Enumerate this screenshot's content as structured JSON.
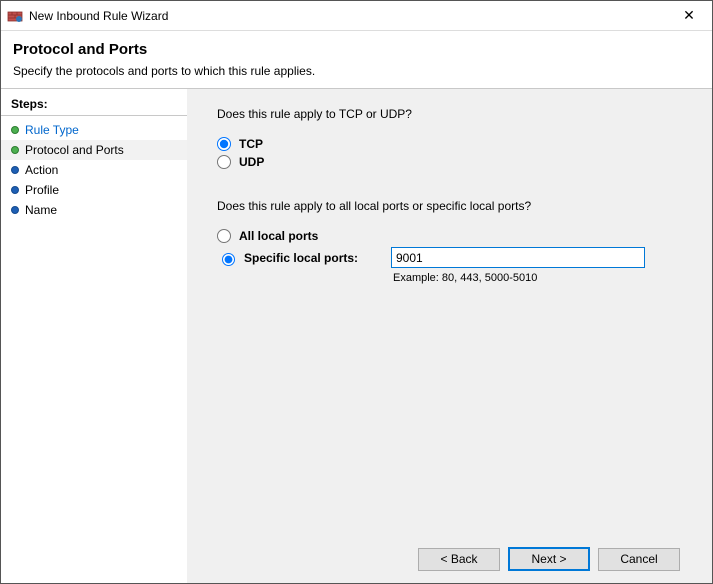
{
  "window": {
    "title": "New Inbound Rule Wizard",
    "close_symbol": "✕"
  },
  "header": {
    "title": "Protocol and Ports",
    "subtitle": "Specify the protocols and ports to which this rule applies."
  },
  "sidebar": {
    "label": "Steps:",
    "items": [
      {
        "label": "Rule Type"
      },
      {
        "label": "Protocol and Ports"
      },
      {
        "label": "Action"
      },
      {
        "label": "Profile"
      },
      {
        "label": "Name"
      }
    ]
  },
  "content": {
    "question1": "Does this rule apply to TCP or UDP?",
    "opt_tcp": "TCP",
    "opt_udp": "UDP",
    "question2": "Does this rule apply to all local ports or specific local ports?",
    "opt_all": "All local ports",
    "opt_specific": "Specific local ports:",
    "ports_value": "9001",
    "example": "Example: 80, 443, 5000-5010"
  },
  "footer": {
    "back": "< Back",
    "next": "Next >",
    "cancel": "Cancel"
  }
}
